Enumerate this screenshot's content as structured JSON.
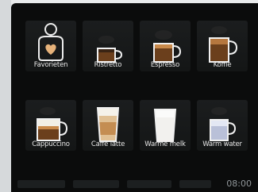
{
  "tiles": [
    {
      "label": "Favorieten",
      "icon": "heart-person-icon"
    },
    {
      "label": "Ristretto",
      "icon": "ristretto-cup-icon"
    },
    {
      "label": "Espresso",
      "icon": "espresso-cup-icon"
    },
    {
      "label": "Koffie",
      "icon": "koffie-cup-icon"
    },
    {
      "label": "Cappuccino",
      "icon": "cappuccino-cup-icon"
    },
    {
      "label": "Caffè latte",
      "icon": "caffe-latte-glass-icon"
    },
    {
      "label": "Warme melk",
      "icon": "warm-milk-glass-icon"
    },
    {
      "label": "Warm water",
      "icon": "warm-water-cup-icon"
    }
  ],
  "status": {
    "time": "08:00"
  },
  "colors": {
    "coffee": "#6b3f1c",
    "crema": "#c98a4b",
    "milk": "#f2efe6",
    "accent": "#e6b27a"
  }
}
